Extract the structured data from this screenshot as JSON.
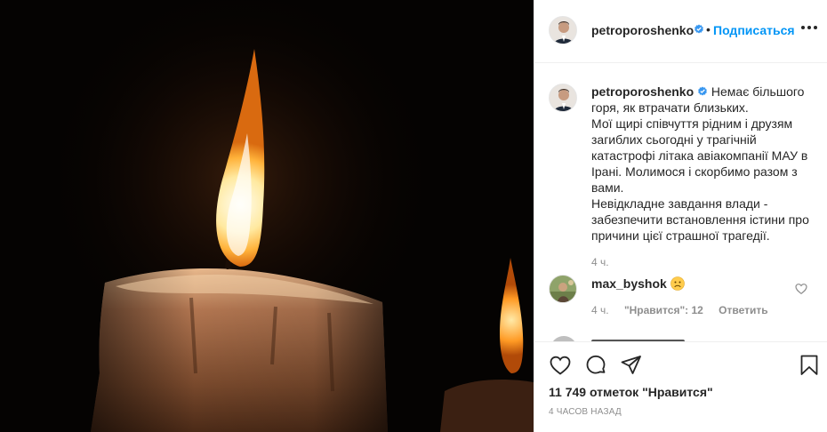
{
  "post": {
    "author": "petroporoshenko",
    "follow_label": "Подписаться",
    "separator": "•",
    "more_icon": "more-horizontal-icon",
    "verified_color": "#3897f0",
    "accent": "#0095f6"
  },
  "caption": {
    "username": "petroporoshenko",
    "lines": [
      "Немає більшого горя, як втрачати близьких.",
      "Мої щирі співчуття рідним і друзям загиблих сьогодні у трагічній катастрофі літака авіакомпанії МАУ в Ірані. Молимося і скорбимо разом з вами.",
      "Невідкладне завдання влади - забезпечити встановлення істини про причини цієї страшної трагедії."
    ],
    "time": "4 ч."
  },
  "comments": [
    {
      "username": "max_byshok",
      "emoji": "sad-face-emoji",
      "time": "4 ч.",
      "likes_label": "\"Нравится\": 12",
      "reply_label": "Ответить"
    }
  ],
  "actions": {
    "icons": [
      "heart-icon",
      "comment-icon",
      "share-icon",
      "bookmark-icon"
    ],
    "likes_text": "11 749 отметок \"Нравится\"",
    "posted_ago": "4 часов назад"
  }
}
